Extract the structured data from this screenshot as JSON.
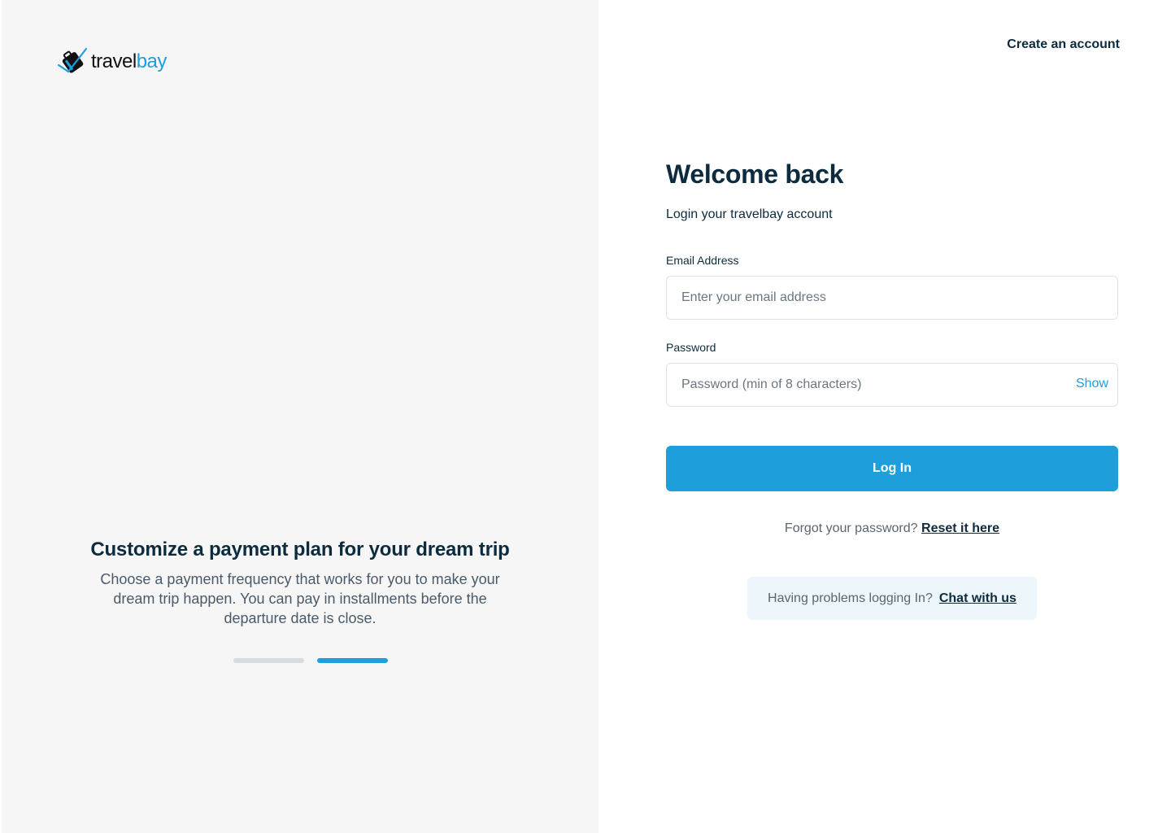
{
  "brand": {
    "name_part1": "travel",
    "name_part2": "bay",
    "logo_icon": "suitcase-plane-icon",
    "accent_color": "#1e9fdc",
    "dark_color": "#0d2b3e"
  },
  "header": {
    "create_account_label": "Create an account"
  },
  "promo": {
    "title": "Customize a payment plan for your dream trip",
    "text": "Choose a payment frequency that works for you to make your dream trip happen. You can pay in installments before the departure date is close.",
    "slides_total": 2,
    "active_slide": 2
  },
  "login": {
    "heading": "Welcome back",
    "subheading": "Login your travelbay account",
    "email_label": "Email Address",
    "email_placeholder": "Enter your email address",
    "email_value": "",
    "password_label": "Password",
    "password_placeholder": "Password (min of 8 characters)",
    "password_value": "",
    "show_label": "Show",
    "submit_label": "Log In",
    "forgot_text": "Forgot your password?",
    "reset_link": "Reset it here",
    "help_text": "Having problems logging In?",
    "chat_link": "Chat with us"
  }
}
